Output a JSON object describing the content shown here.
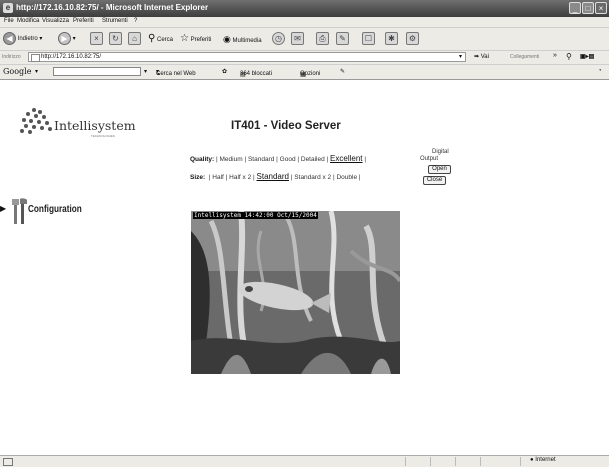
{
  "window": {
    "title": "http://172.16.10.82:75/ - Microsoft Internet Explorer"
  },
  "menu": [
    "File",
    "Modifica",
    "Visualizza",
    "Preferiti",
    "Strumenti",
    "?"
  ],
  "toolbar": {
    "back_label": "Indietro",
    "search_label": "Cerca",
    "favorites_label": "Preferiti",
    "multimedia_label": "Multimedia"
  },
  "address": {
    "label": "Indirizzo",
    "url": "http://172.16.10.82:75/",
    "go_label": "Vai",
    "links_label": "Collegamenti"
  },
  "google": {
    "logo": "Google",
    "search_web": "Cerca nel Web",
    "blocked": "364 bloccati",
    "options": "Opzioni"
  },
  "page": {
    "logo_name": "Intellisystem",
    "logo_tag": "TECHNOLOGIES",
    "nav_config": "Configuration",
    "heading": "IT401 - Video Server",
    "quality_label": "Quality:",
    "quality_options": [
      "Medium",
      "Standard",
      "Good",
      "Detailed",
      "Excellent"
    ],
    "quality_selected": "Excellent",
    "size_label": "Size:",
    "size_options": [
      "Half",
      "Half x 2",
      "Standard",
      "Standard x 2",
      "Double"
    ],
    "size_selected": "Standard",
    "digital_line1": "Digital",
    "digital_line2": "Output",
    "open_label": "Open",
    "close_label": "Close",
    "video_caption": "Intellisystem 14:42:00 Oct/15/2004"
  },
  "status": {
    "zone": "Internet"
  },
  "colors": {
    "titlebar": "#4a4a4a",
    "chrome": "#ecebe6"
  }
}
